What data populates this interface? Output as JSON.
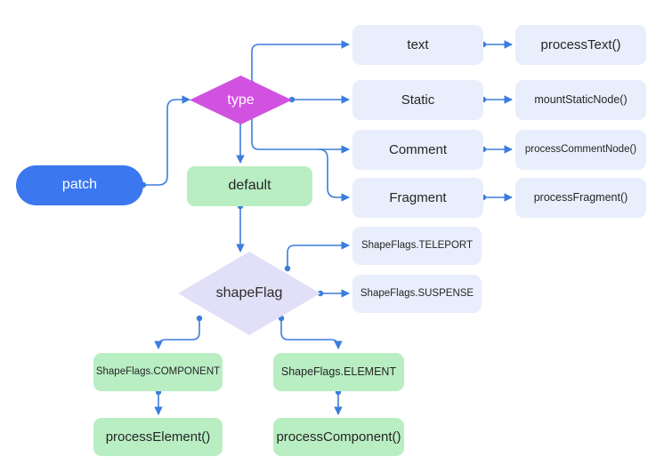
{
  "diagram": {
    "title": "patch flow",
    "background": "#ffffff",
    "edge_color": "#3b7ddd",
    "colors": {
      "pill_blue": "#3b77ee",
      "box_blue": "#e8eefb",
      "box_green": "#b9eec3",
      "diamond_magenta": "#d152e0",
      "diamond_lavender": "#e2e0f8",
      "edge": "#3b7ddd",
      "text_dark": "#262626",
      "text_light": "#ffffff"
    },
    "nodes": {
      "patch": "patch",
      "type": "type",
      "default": "default",
      "shape_flag": "shapeFlag",
      "text": "text",
      "static": "Static",
      "comment": "Comment",
      "fragment": "Fragment",
      "process_text": "processText()",
      "mount_static_node": "mountStaticNode()",
      "process_comment_node": "processCommentNode()",
      "process_fragment": "processFragment()",
      "shapeflags_teleport": "ShapeFlags.TELEPORT",
      "shapeflags_suspense": "ShapeFlags.SUSPENSE",
      "shapeflags_component": "ShapeFlags.COMPONENT",
      "shapeflags_element": "ShapeFlags.ELEMENT",
      "process_element": "processElement()",
      "process_component": "processComponent()"
    },
    "edges": [
      {
        "from": "patch",
        "to": "type"
      },
      {
        "from": "type",
        "to": "text"
      },
      {
        "from": "type",
        "to": "static"
      },
      {
        "from": "type",
        "to": "comment"
      },
      {
        "from": "type",
        "to": "fragment"
      },
      {
        "from": "type",
        "to": "default"
      },
      {
        "from": "text",
        "to": "process_text"
      },
      {
        "from": "static",
        "to": "mount_static_node"
      },
      {
        "from": "comment",
        "to": "process_comment_node"
      },
      {
        "from": "fragment",
        "to": "process_fragment"
      },
      {
        "from": "default",
        "to": "shape_flag"
      },
      {
        "from": "shape_flag",
        "to": "shapeflags_teleport"
      },
      {
        "from": "shape_flag",
        "to": "shapeflags_suspense"
      },
      {
        "from": "shape_flag",
        "to": "shapeflags_component"
      },
      {
        "from": "shape_flag",
        "to": "shapeflags_element"
      },
      {
        "from": "shapeflags_component",
        "to": "process_element"
      },
      {
        "from": "shapeflags_element",
        "to": "process_component"
      }
    ]
  }
}
